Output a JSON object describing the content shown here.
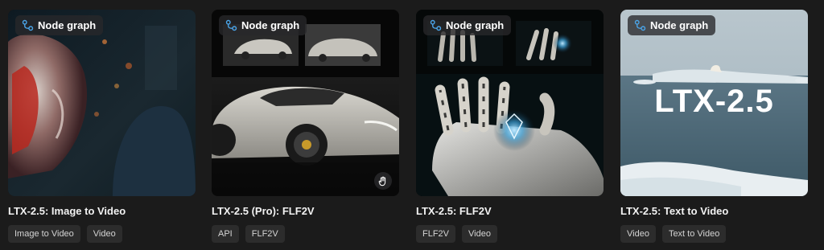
{
  "cards": [
    {
      "badge": "Node graph",
      "title": "LTX-2.5: Image to Video",
      "tags": [
        "Image to Video",
        "Video"
      ]
    },
    {
      "badge": "Node graph",
      "title": "LTX-2.5 (Pro): FLF2V",
      "tags": [
        "API",
        "FLF2V"
      ]
    },
    {
      "badge": "Node graph",
      "title": "LTX-2.5: FLF2V",
      "tags": [
        "FLF2V",
        "Video"
      ]
    },
    {
      "badge": "Node graph",
      "title": "LTX-2.5: Text to Video",
      "tags": [
        "Video",
        "Text to Video"
      ],
      "thumbnail_text": "LTX-2.5"
    }
  ],
  "icons": {
    "badge": "node-graph-icon",
    "corner": "api-hand-icon"
  },
  "colors": {
    "background": "#1b1b1b",
    "badge_icon": "#4aa3e6",
    "tag_bg": "#2c2c2c"
  }
}
